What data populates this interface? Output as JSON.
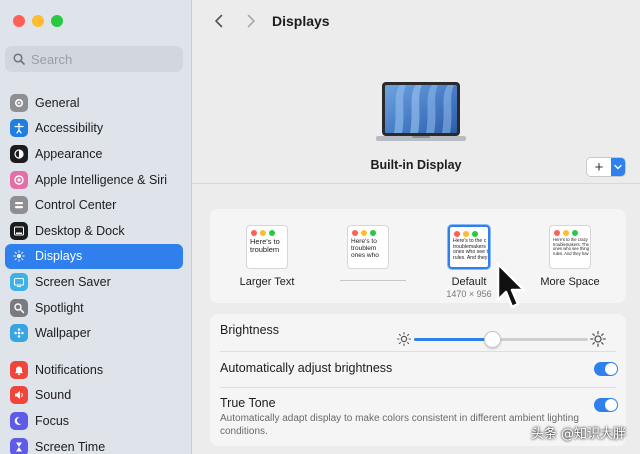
{
  "window": {
    "traffic_colors": [
      "#ff5f57",
      "#febc2e",
      "#28c840"
    ]
  },
  "sidebar": {
    "search_placeholder": "Search",
    "groups": [
      [
        {
          "label": "General",
          "icon": "gear-icon",
          "color": "#8e8e93"
        },
        {
          "label": "Accessibility",
          "icon": "accessibility-icon",
          "color": "#1e7fe0"
        },
        {
          "label": "Appearance",
          "icon": "appearance-icon",
          "color": "#1c1c1e"
        },
        {
          "label": "Apple Intelligence & Siri",
          "icon": "siri-icon",
          "color": "#e36fa8"
        },
        {
          "label": "Control Center",
          "icon": "control-center-icon",
          "color": "#8e8e93"
        },
        {
          "label": "Desktop & Dock",
          "icon": "dock-icon",
          "color": "#1c1c1e"
        },
        {
          "label": "Displays",
          "icon": "sun-icon",
          "color": "#2f80ed",
          "selected": true
        },
        {
          "label": "Screen Saver",
          "icon": "screen-saver-icon",
          "color": "#38b2e8"
        },
        {
          "label": "Spotlight",
          "icon": "spotlight-icon",
          "color": "#7a7a80"
        },
        {
          "label": "Wallpaper",
          "icon": "wallpaper-icon",
          "color": "#37a5e0"
        }
      ],
      [
        {
          "label": "Notifications",
          "icon": "bell-icon",
          "color": "#f0453a"
        },
        {
          "label": "Sound",
          "icon": "speaker-icon",
          "color": "#f0453a"
        },
        {
          "label": "Focus",
          "icon": "moon-icon",
          "color": "#5e5ce6"
        },
        {
          "label": "Screen Time",
          "icon": "hourglass-icon",
          "color": "#5e5ce6"
        }
      ]
    ]
  },
  "topbar": {
    "title": "Displays"
  },
  "display": {
    "name": "Built-in Display",
    "add_label": "+"
  },
  "resolution": {
    "options": [
      {
        "label": "Larger Text",
        "thumb_text": "Here's to\ntroublem",
        "size": 7.5
      },
      {
        "label": "",
        "thumb_text": "Here's to\ntroublem\nones who",
        "size": 6.5
      },
      {
        "label": "Default",
        "sub": "1470 × 956",
        "thumb_text": "Here's to the c\ntroublemakers\nones who see t\nrules. And they",
        "size": 5.2,
        "selected": true
      },
      {
        "label": "More Space",
        "thumb_text": "Here's to the crazy\ntroublemakers. The\nones who see thing\nrules. And they hav",
        "size": 4.2
      }
    ]
  },
  "settings": {
    "brightness_label": "Brightness",
    "brightness_value": 0.45,
    "auto_brightness_label": "Automatically adjust brightness",
    "auto_brightness_on": true,
    "true_tone_label": "True Tone",
    "true_tone_desc": "Automatically adapt display to make colors consistent in different ambient lighting conditions.",
    "true_tone_on": true
  },
  "watermark": "头条 @知识大胖",
  "colors": {
    "accent": "#2f80ed",
    "sidebar_bg": "#dfe3ea",
    "main_bg": "#ececec"
  }
}
